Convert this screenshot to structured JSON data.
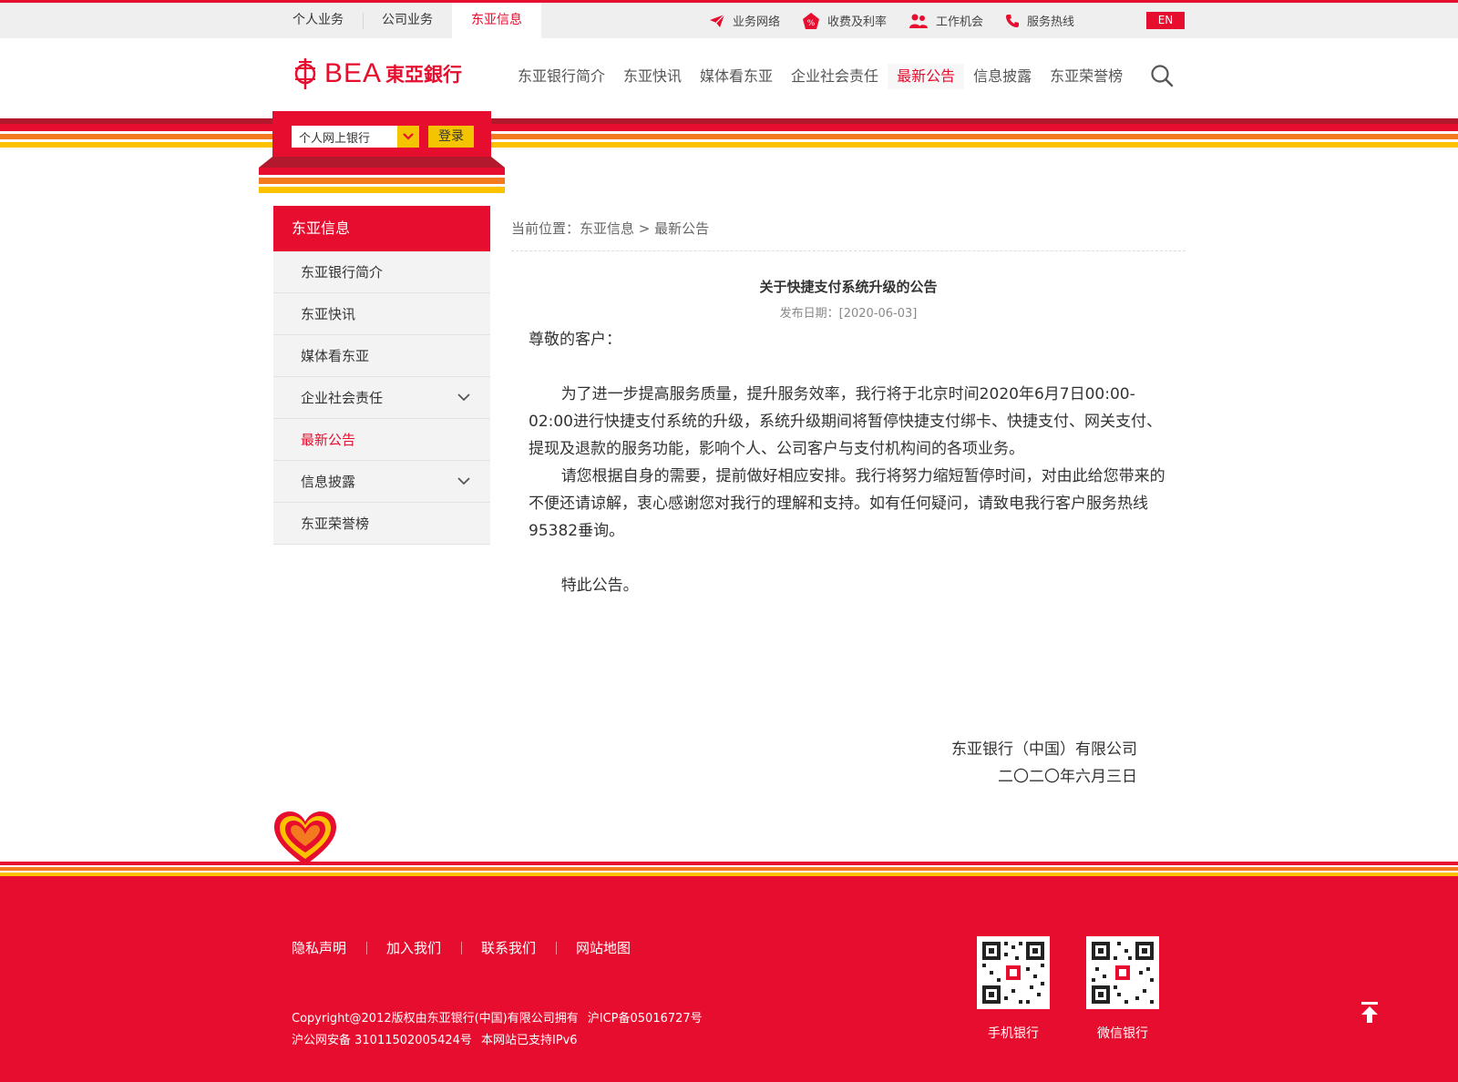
{
  "topbar": {
    "tabs": [
      "个人业务",
      "公司业务",
      "东亚信息"
    ],
    "active_tab": "东亚信息",
    "utils": [
      "业务网络",
      "收费及利率",
      "工作机会",
      "服务热线"
    ],
    "lang": "EN"
  },
  "header": {
    "logo_text": "BEA",
    "logo_cn": "東亞銀行",
    "nav": [
      "东亚银行简介",
      "东亚快讯",
      "媒体看东亚",
      "企业社会责任",
      "最新公告",
      "信息披露",
      "东亚荣誉榜"
    ],
    "active_nav": "最新公告"
  },
  "login": {
    "select_value": "个人网上银行",
    "button": "登录"
  },
  "sidebar": {
    "title": "东亚信息",
    "items": [
      {
        "label": "东亚银行简介",
        "expandable": false
      },
      {
        "label": "东亚快讯",
        "expandable": false
      },
      {
        "label": "媒体看东亚",
        "expandable": false
      },
      {
        "label": "企业社会责任",
        "expandable": true
      },
      {
        "label": "最新公告",
        "expandable": false,
        "active": true
      },
      {
        "label": "信息披露",
        "expandable": true
      },
      {
        "label": "东亚荣誉榜",
        "expandable": false
      }
    ]
  },
  "breadcrumb": "当前位置：东亚信息 > 最新公告",
  "article": {
    "title": "关于快捷支付系统升级的公告",
    "date": "发布日期：[2020-06-03]",
    "greeting": "尊敬的客户：",
    "para1": "为了进一步提高服务质量，提升服务效率，我行将于北京时间2020年6月7日00:00-02:00进行快捷支付系统的升级，系统升级期间将暂停快捷支付绑卡、快捷支付、网关支付、提现及退款的服务功能，影响个人、公司客户与支付机构间的各项业务。",
    "para2": "请您根据自身的需要，提前做好相应安排。我行将努力缩短暂停时间，对由此给您带来的不便还请谅解，衷心感谢您对我行的理解和支持。如有任何疑问，请致电我行客户服务热线95382垂询。",
    "closing": "特此公告。",
    "signer": "东亚银行（中国）有限公司",
    "sign_date": "二〇二〇年六月三日"
  },
  "footer": {
    "links": [
      "隐私声明",
      "加入我们",
      "联系我们",
      "网站地图"
    ],
    "copyright": "Copyright@2012版权由东亚银行(中国)有限公司拥有",
    "icp": "沪ICP备05016727号",
    "police": "沪公网安备 31011502005424号",
    "ipv6": "本网站已支持IPv6",
    "qr_mobile": "手机银行",
    "qr_wechat": "微信银行"
  },
  "colors": {
    "brand_red": "#e60d2e",
    "stripe_dark": "#b2192c",
    "stripe_orange": "#f47a20",
    "stripe_yellow": "#fcc200"
  }
}
